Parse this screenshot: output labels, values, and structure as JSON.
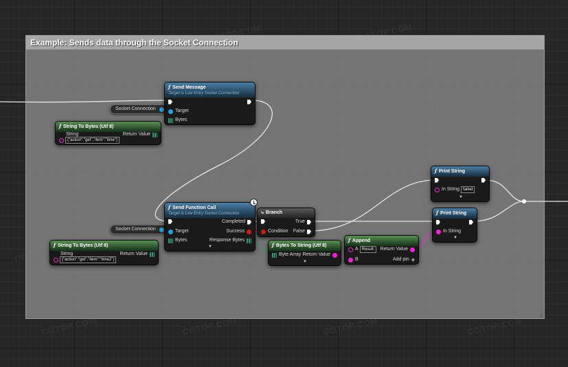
{
  "comment": {
    "title": "Example: Sends data through the Socket Connection"
  },
  "nodes": {
    "send_message": {
      "title": "Send Message",
      "subtitle": "Target is Low Entry Socket Connection",
      "pin_target": "Target",
      "pin_bytes": "Bytes"
    },
    "socket_conn_1": {
      "label": "Socket Connection"
    },
    "stb1": {
      "title": "String To Bytes (Utf 8)",
      "pin_string": "String",
      "string_value": "{\"action\":\"get\",\"item\":\"time\"}",
      "pin_return": "Return Value"
    },
    "send_function_call": {
      "title": "Send Function Call",
      "subtitle": "Target is Low Entry Socket Connection",
      "pin_completed": "Completed",
      "pin_target": "Target",
      "pin_success": "Success",
      "pin_bytes": "Bytes",
      "pin_response": "Response Bytes"
    },
    "socket_conn_2": {
      "label": "Socket Connection"
    },
    "stb2": {
      "title": "String To Bytes (Utf 8)",
      "pin_string": "String",
      "string_value": "{\"action\":\"get\",\"item\":\"time2\"}",
      "pin_return": "Return Value"
    },
    "branch": {
      "title": "Branch",
      "pin_true": "True",
      "pin_false": "False",
      "pin_condition": "Condition"
    },
    "bts": {
      "title": "Bytes To String (Utf 8)",
      "pin_byte_array": "Byte Array",
      "pin_return": "Return Value"
    },
    "append": {
      "title": "Append",
      "pin_a": "A",
      "a_value": "Result:",
      "pin_b": "B",
      "pin_return": "Return Value",
      "add_pin": "Add pin"
    },
    "print1": {
      "title": "Print String",
      "pin_in_string": "In String",
      "in_string_value": "failed"
    },
    "print2": {
      "title": "Print String",
      "pin_in_string": "In String"
    }
  },
  "watermark": "CGTOP.COM",
  "colors": {
    "exec": "#ffffff",
    "object": "#2a9fe0",
    "string": "#f026d6",
    "bool": "#c4201a",
    "bytes": "#2f9a77"
  },
  "icons": [
    "function-icon",
    "branch-icon",
    "clock-icon",
    "exec-pin-icon",
    "data-pin-icon",
    "chevron-down-icon",
    "plus-icon"
  ]
}
